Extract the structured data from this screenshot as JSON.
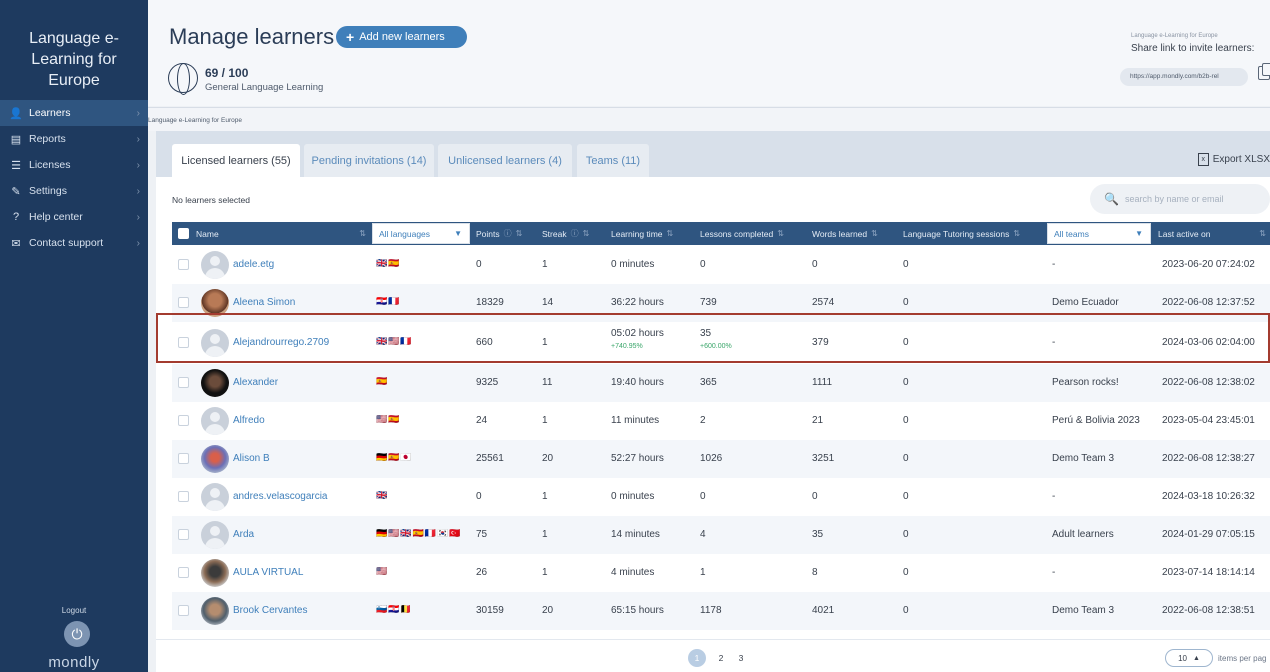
{
  "sidebar": {
    "brand": "Language e-Learning for Europe",
    "items": [
      {
        "label": "Learners",
        "icon": "user-icon",
        "glyph": "👤",
        "active": true
      },
      {
        "label": "Reports",
        "icon": "reports-icon",
        "glyph": "▤",
        "active": false
      },
      {
        "label": "Licenses",
        "icon": "licenses-icon",
        "glyph": "☰",
        "active": false
      },
      {
        "label": "Settings",
        "icon": "settings-icon",
        "glyph": "✎",
        "active": false
      },
      {
        "label": "Help center",
        "icon": "help-icon",
        "glyph": "?",
        "active": false
      },
      {
        "label": "Contact support",
        "icon": "support-icon",
        "glyph": "✉",
        "active": false
      }
    ],
    "logout_label": "Logout",
    "footer_logo": "mondly"
  },
  "header": {
    "title": "Manage learners",
    "add_button": "Add new learners",
    "licenses_count": "69 / 100",
    "licenses_label": "General Language Learning",
    "share_org": "Language e-Learning for Europe",
    "share_title": "Share link to invite learners:",
    "share_link": "https://app.mondly.com/b2b-rel"
  },
  "org_label": "Language e-Learning for Europe",
  "tabs": [
    {
      "label": "Licensed learners (55)",
      "active": true
    },
    {
      "label": "Pending invitations (14)",
      "active": false
    },
    {
      "label": "Unlicensed learners (4)",
      "active": false
    },
    {
      "label": "Teams (11)",
      "active": false
    }
  ],
  "export_label": "Export XLSX",
  "selection_note": "No learners selected",
  "search_placeholder": "search by name or email",
  "columns": {
    "name": "Name",
    "languages": "All languages",
    "points": "Points",
    "streak": "Streak",
    "learning_time": "Learning time",
    "lessons": "Lessons completed",
    "words": "Words learned",
    "tutoring": "Language Tutoring sessions",
    "teams": "All teams",
    "last_active": "Last active on"
  },
  "rows": [
    {
      "name": "adele.etg",
      "avatar": "placeholder",
      "flags": "🇬🇧🇪🇸",
      "points": "0",
      "streak": "1",
      "time": "0 minutes",
      "lessons": "0",
      "words": "0",
      "tutoring": "0",
      "team": "-",
      "last_active": "2023-06-20 07:24:02"
    },
    {
      "name": "Aleena Simon",
      "avatar": "photo1",
      "flags": "🇭🇷🇫🇷",
      "points": "18329",
      "streak": "14",
      "time": "36:22 hours",
      "lessons": "739",
      "words": "2574",
      "tutoring": "0",
      "team": "Demo Ecuador",
      "last_active": "2022-06-08 12:37:52"
    },
    {
      "name": "Alejandrourrego.2709",
      "avatar": "placeholder",
      "flags": "🇬🇧🇺🇸🇫🇷",
      "points": "660",
      "streak": "1",
      "time": "05:02 hours",
      "time_delta": "+740.95%",
      "lessons": "35",
      "lessons_delta": "+600.00%",
      "words": "379",
      "tutoring": "0",
      "team": "-",
      "last_active": "2024-03-06 02:04:00"
    },
    {
      "name": "Alexander",
      "avatar": "photo2",
      "flags": "🇪🇸",
      "points": "9325",
      "streak": "11",
      "time": "19:40 hours",
      "lessons": "365",
      "words": "1111",
      "tutoring": "0",
      "team": "Pearson rocks!",
      "last_active": "2022-06-08 12:38:02"
    },
    {
      "name": "Alfredo",
      "avatar": "placeholder",
      "flags": "🇺🇸🇪🇸",
      "points": "24",
      "streak": "1",
      "time": "11 minutes",
      "lessons": "2",
      "words": "21",
      "tutoring": "0",
      "team": "Perú & Bolivia 2023",
      "last_active": "2023-05-04 23:45:01"
    },
    {
      "name": "Alison B",
      "avatar": "photo3",
      "flags": "🇩🇪🇪🇸🇯🇵",
      "points": "25561",
      "streak": "20",
      "time": "52:27 hours",
      "lessons": "1026",
      "words": "3251",
      "tutoring": "0",
      "team": "Demo Team 3",
      "last_active": "2022-06-08 12:38:27"
    },
    {
      "name": "andres.velascogarcia",
      "avatar": "placeholder",
      "flags": "🇬🇧",
      "points": "0",
      "streak": "1",
      "time": "0 minutes",
      "lessons": "0",
      "words": "0",
      "tutoring": "0",
      "team": "-",
      "last_active": "2024-03-18 10:26:32"
    },
    {
      "name": "Arda",
      "avatar": "placeholder",
      "flags": "🇩🇪🇺🇸🇬🇧🇪🇸🇫🇷🇰🇷🇹🇷",
      "points": "75",
      "streak": "1",
      "time": "14 minutes",
      "lessons": "4",
      "words": "35",
      "tutoring": "0",
      "team": "Adult learners",
      "last_active": "2024-01-29 07:05:15"
    },
    {
      "name": "AULA VIRTUAL",
      "avatar": "photo4",
      "flags": "🇺🇸",
      "points": "26",
      "streak": "1",
      "time": "4 minutes",
      "lessons": "1",
      "words": "8",
      "tutoring": "0",
      "team": "-",
      "last_active": "2023-07-14 18:14:14"
    },
    {
      "name": "Brook Cervantes",
      "avatar": "photo5",
      "flags": "🇸🇮🇭🇷🇧🇪",
      "points": "30159",
      "streak": "20",
      "time": "65:15 hours",
      "lessons": "1178",
      "words": "4021",
      "tutoring": "0",
      "team": "Demo Team 3",
      "last_active": "2022-06-08 12:38:51"
    }
  ],
  "pagination": {
    "pages": [
      "1",
      "2",
      "3"
    ],
    "current": "1",
    "per_page": "10",
    "per_page_label": "items per pag"
  },
  "colors": {
    "sidebar": "#1e3a5f",
    "accent": "#3f7fba",
    "table_header": "#2f5580",
    "highlight": "#a33b2f",
    "positive": "#3aa66a"
  }
}
